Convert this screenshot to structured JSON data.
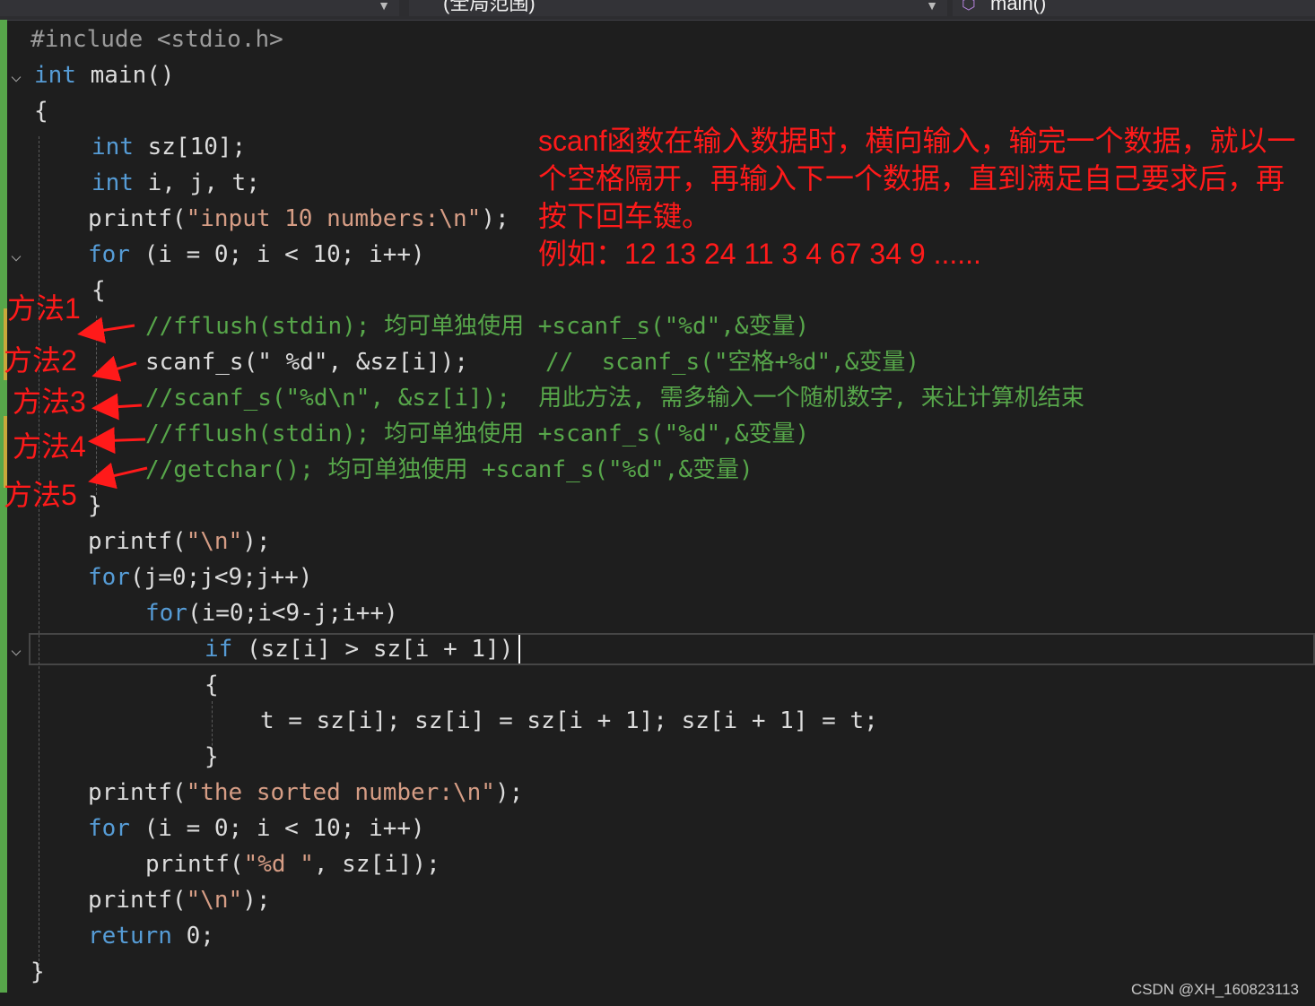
{
  "navigation": {
    "scope_label": "",
    "global_scope_label": "(全局范围)",
    "member_label": "main()",
    "member_icon": "cube-icon"
  },
  "code": {
    "l1": "#include <stdio.h>",
    "l2_kw": "int",
    "l2_rest": " main()",
    "l3": "{",
    "l4_kw": "int",
    "l4_rest": " sz[10];",
    "l5_kw": "int",
    "l5_rest": " i, j, t;",
    "l6_fn": "printf(",
    "l6_str": "\"input 10 numbers:\\n\"",
    "l6_end": ");",
    "l7_kw": "for",
    "l7_rest": " (i = 0; i < 10; i++)",
    "l8": "{",
    "l9_comment": "//fflush(stdin); 均可单独使用 +scanf_s(\"%d\",&变量)",
    "l10_code": "scanf_s(\" %d\", &sz[i]);",
    "l10_comment": "//  scanf_s(\"空格+%d\",&变量)",
    "l11_comment": "//scanf_s(\"%d\\n\", &sz[i]);  用此方法, 需多输入一个随机数字, 来让计算机结束",
    "l12_comment": "//fflush(stdin); 均可单独使用 +scanf_s(\"%d\",&变量)",
    "l13_comment": "//getchar(); 均可单独使用 +scanf_s(\"%d\",&变量)",
    "l14": "}",
    "l15_fn": "printf(",
    "l15_str": "\"\\n\"",
    "l15_end": ");",
    "l16_kw": "for",
    "l16_rest": "(j=0;j<9;j++)",
    "l17_kw": "for",
    "l17_rest": "(i=0;i<9-j;i++)",
    "l18_kw": "if",
    "l18_rest": " (sz[i] > sz[i + 1])",
    "l19": "{",
    "l20": "t = sz[i]; sz[i] = sz[i + 1]; sz[i + 1] = t;",
    "l21": "}",
    "l22_fn": "printf(",
    "l22_str": "\"the sorted number:\\n\"",
    "l22_end": ");",
    "l23_kw": "for",
    "l23_rest": " (i = 0; i < 10; i++)",
    "l24_fn": "printf(",
    "l24_str": "\"%d \"",
    "l24_end": ", sz[i]);",
    "l25_fn": "printf(",
    "l25_str": "\"\\n\"",
    "l25_end": ");",
    "l26_kw": "return",
    "l26_rest": " 0;",
    "l27": "}"
  },
  "annotation": {
    "text": "scanf函数在输入数据时，横向输入，输完一个数据，就以一个空格隔开，再输入下一个数据，直到满足自己要求后，再按下回车键。",
    "example": "例如：12 13 24 11 3 4 67 34 9 ......"
  },
  "methods": [
    "方法1",
    "方法2",
    "方法3",
    "方法4",
    "方法5"
  ],
  "watermark": "CSDN @XH_160823113",
  "colors": {
    "background": "#1e1e1e",
    "keyword": "#569cd6",
    "comment": "#57a64a",
    "string": "#d69d85",
    "annotation": "#ff1a1a"
  }
}
